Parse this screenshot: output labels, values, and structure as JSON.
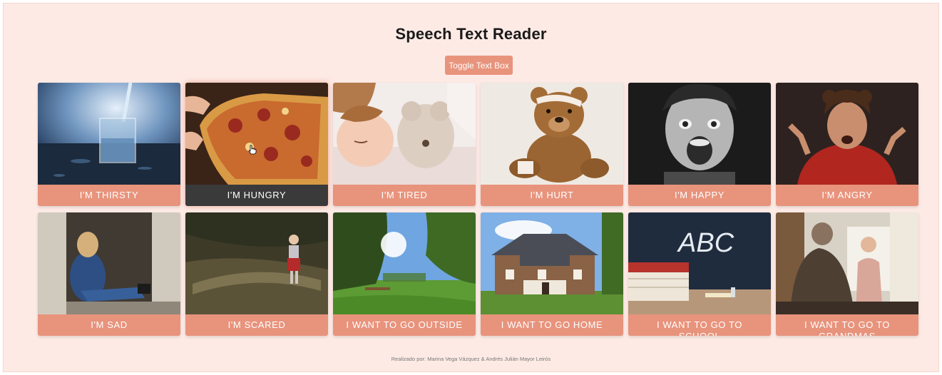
{
  "header": {
    "title": "Speech Text Reader"
  },
  "toolbar": {
    "toggle_label": "Toggle Text Box"
  },
  "cards": [
    {
      "label": "I'M THIRSTY",
      "icon": "water-glass-photo"
    },
    {
      "label": "I'M HUNGRY",
      "icon": "pizza-photo"
    },
    {
      "label": "I'M TIRED",
      "icon": "sleeping-child-photo"
    },
    {
      "label": "I'M HURT",
      "icon": "bandaged-teddy-bear-photo"
    },
    {
      "label": "I'M HAPPY",
      "icon": "happy-boy-photo"
    },
    {
      "label": "I'M ANGRY",
      "icon": "angry-boy-photo"
    },
    {
      "label": "I'M SAD",
      "icon": "sad-child-photo"
    },
    {
      "label": "I'M SCARED",
      "icon": "child-in-woods-photo"
    },
    {
      "label": "I WANT TO GO OUTSIDE",
      "icon": "park-photo"
    },
    {
      "label": "I WANT TO GO HOME",
      "icon": "house-photo"
    },
    {
      "label": "I WANT TO GO TO SCHOOL",
      "icon": "chalkboard-photo"
    },
    {
      "label": "I WANT TO GO TO GRANDMAS",
      "icon": "grandma-child-photo"
    }
  ],
  "footer": {
    "credits": "Realizado por: Marina Vega Vázquez & Andrés Julián Mayor Leirós"
  },
  "colors": {
    "accent": "#e8937c",
    "background": "#fdeae5",
    "active_label": "#3a3a3a"
  }
}
